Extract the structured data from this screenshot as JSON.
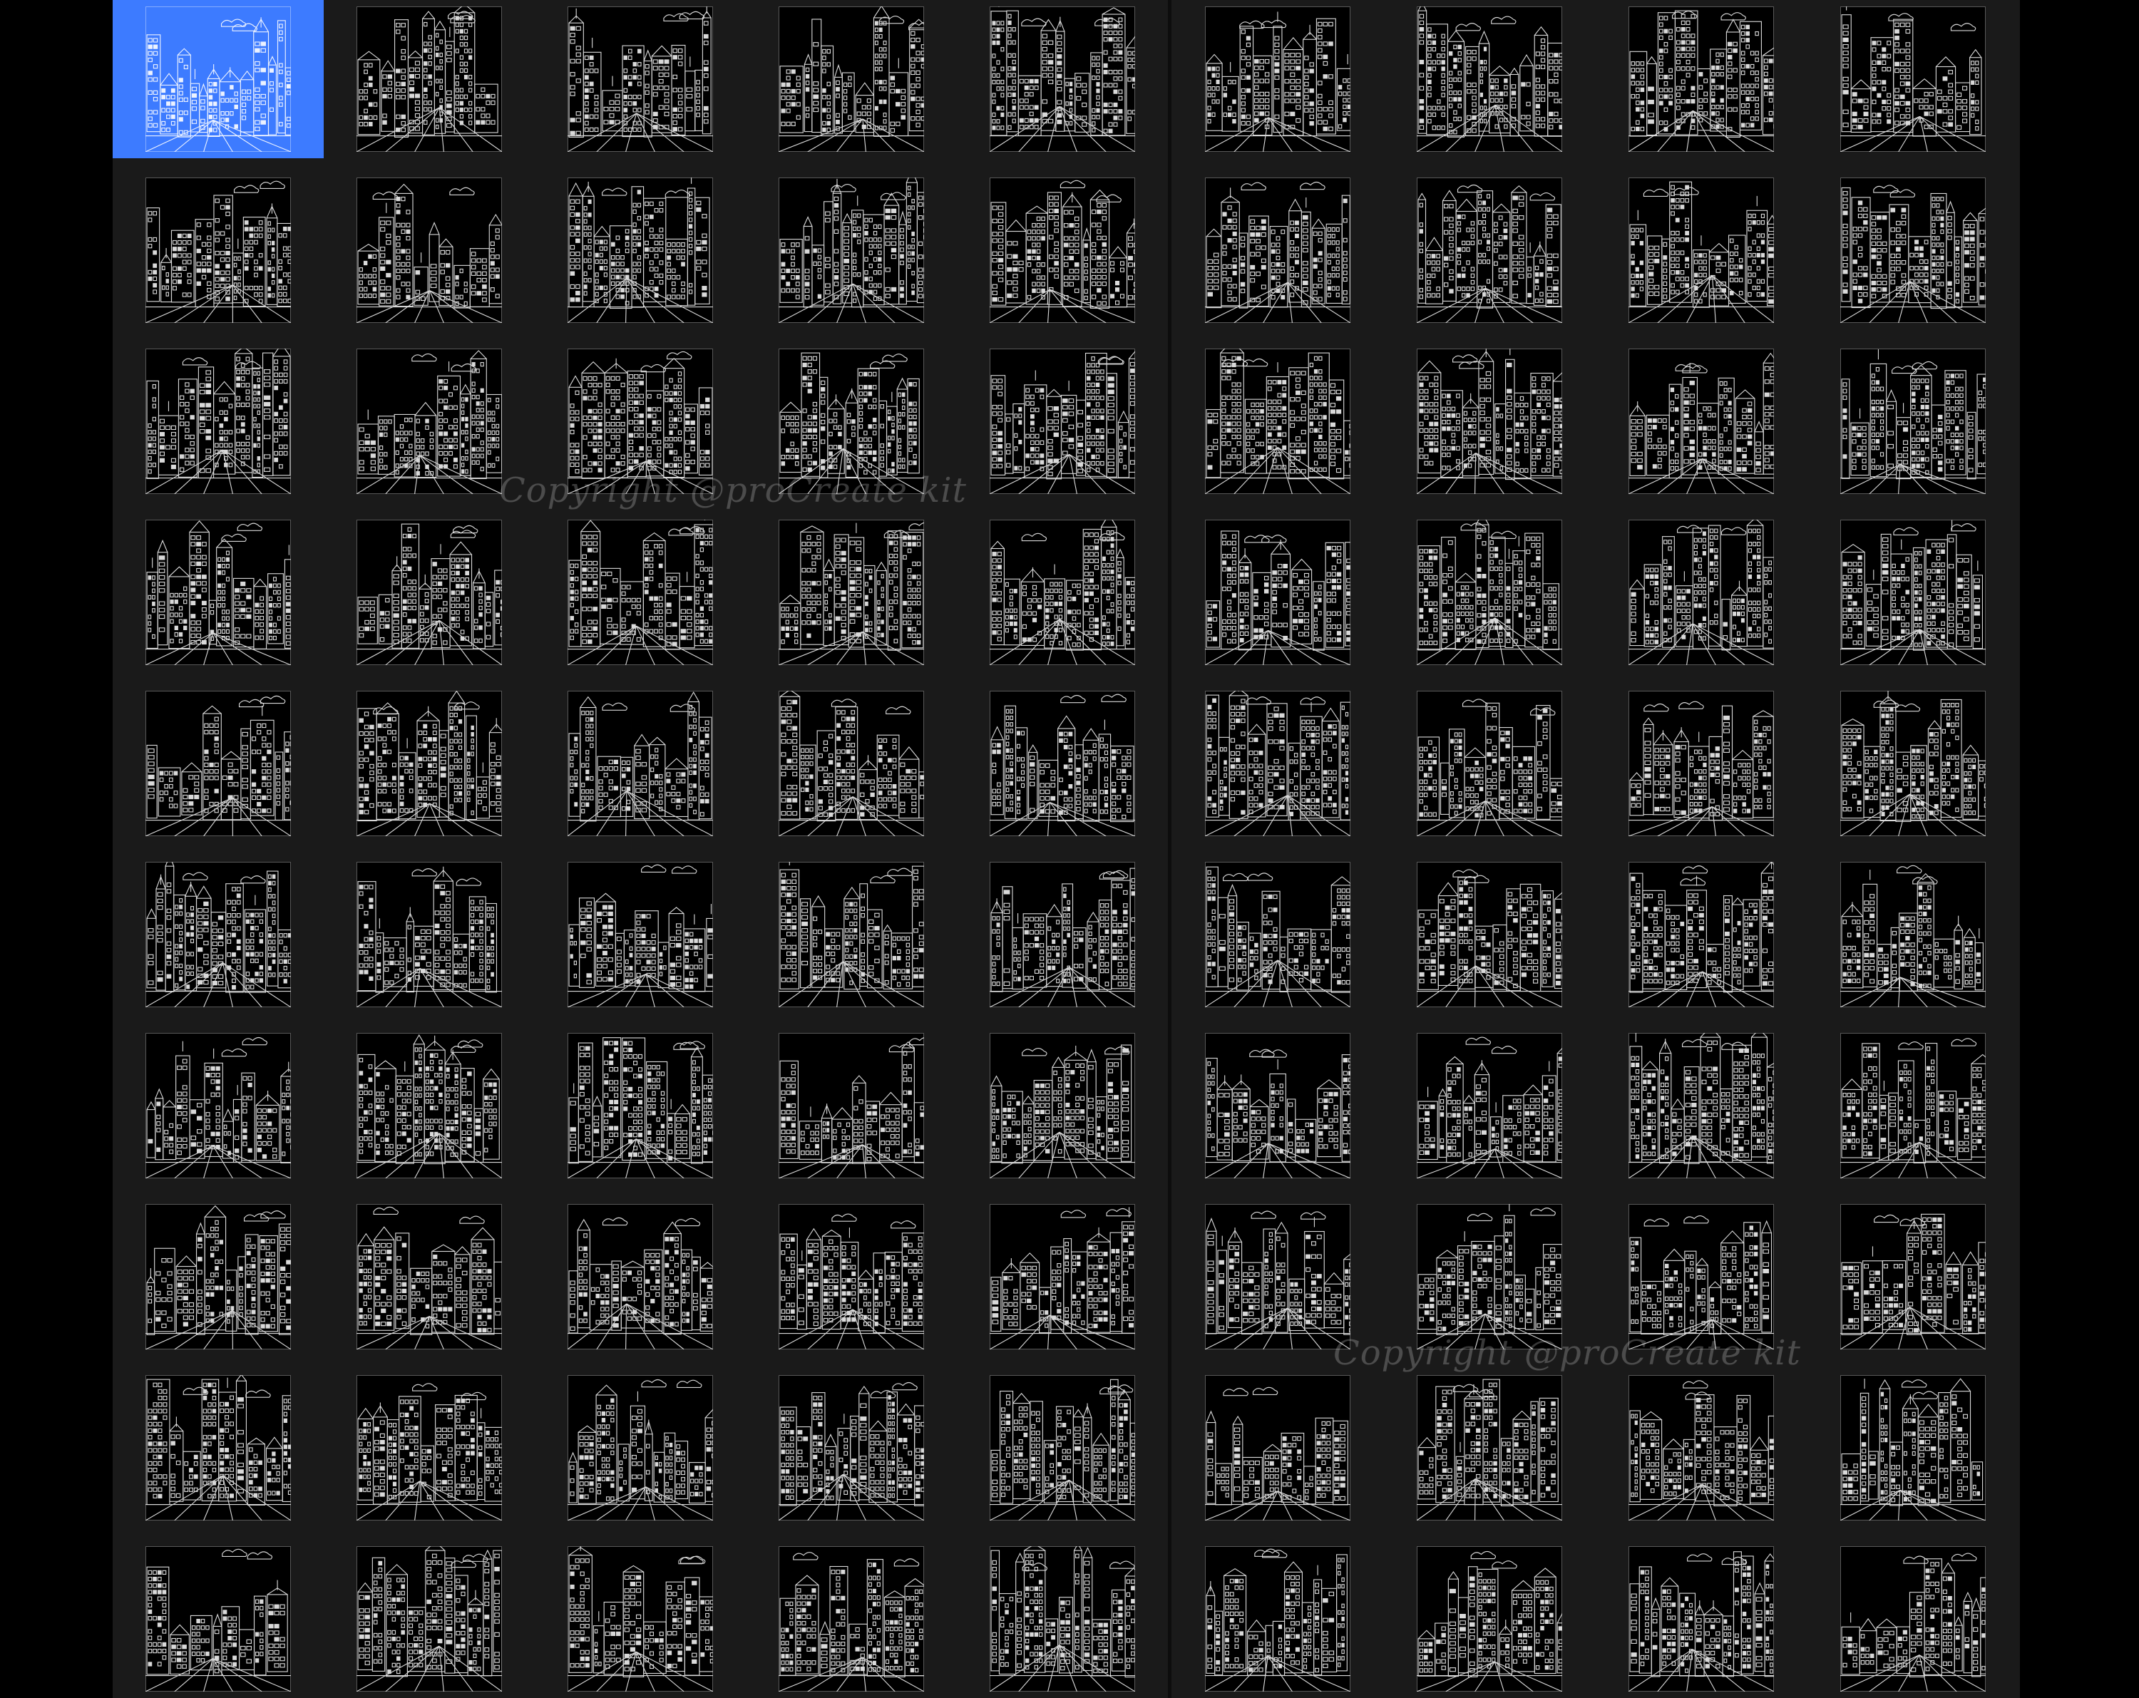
{
  "gallery": {
    "left_panel": {
      "columns": 5,
      "rows": 10,
      "thumbnail_style": "white line-art city street on black"
    },
    "right_panel": {
      "columns": 4,
      "rows": 10,
      "thumbnail_style": "white line-art city street on black"
    },
    "selected_item": {
      "panel": "left",
      "row": 1,
      "column": 1
    }
  },
  "watermarks": [
    "Copyright @proCreate kit",
    "Copyright @proCreate kit"
  ],
  "colors": {
    "background": "#000000",
    "panel": "#1a1a1a",
    "selection": "#3d7bff",
    "line_art": "#ffffff"
  },
  "icons": [
    "city-street-lineart-thumbnail"
  ]
}
